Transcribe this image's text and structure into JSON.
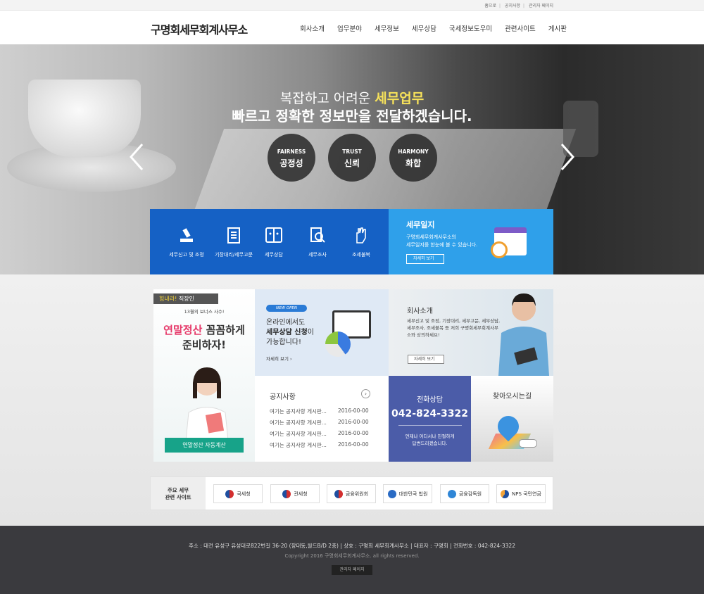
{
  "top_links": [
    "홈으로",
    "공지사항",
    "관리자 페이지"
  ],
  "header": {
    "logo": "구명회세무회계사무소",
    "nav": [
      "회사소개",
      "업무분야",
      "세무정보",
      "세무상담",
      "국세정보도우미",
      "관련사이트",
      "게시판"
    ]
  },
  "hero": {
    "line1_prefix": "복잡하고 어려운 ",
    "line1_highlight": "세무업무",
    "line2": "빠르고 정확한 정보만을 전달하겠습니다.",
    "values": [
      {
        "en": "FAIRNESS",
        "ko": "공정성"
      },
      {
        "en": "TRUST",
        "ko": "신뢰"
      },
      {
        "en": "HARMONY",
        "ko": "화합"
      }
    ]
  },
  "services": [
    {
      "label": "세무신고 및 조정",
      "icon": "seal-stamp-icon"
    },
    {
      "label": "기장대리/세무고문",
      "icon": "document-list-icon"
    },
    {
      "label": "세무상담",
      "icon": "finder-face-icon"
    },
    {
      "label": "세무조사",
      "icon": "magnify-doc-icon"
    },
    {
      "label": "조세불복",
      "icon": "raised-hand-icon"
    }
  ],
  "diary": {
    "title": "세무일지",
    "desc_line1": "구명회세무회계사무소의",
    "desc_line2": "세무일지를 한눈에 볼 수 있습니다.",
    "button": "자세히 보기"
  },
  "promo": {
    "tag_hl": "힘내라!",
    "tag": " 직장인",
    "sub": "13월의 보너스 사수!",
    "head1_hl": "연말정산",
    "head1": " 꼼꼼하게",
    "head2": "준비하자!",
    "button": "연말정산 자동계산"
  },
  "online": {
    "badge": "NEW OPEN",
    "line1": "온라인에서도",
    "line2_bold": "세무상담 신청",
    "line2": "이",
    "line3": "가능합니다!",
    "more": "자세히 보기"
  },
  "company": {
    "title": "회사소개",
    "desc": "세무신고 및 조정, 기장대리, 세무고문, 세무상담, 세무조사, 조세불복 등 저희 구명회세무회계사무소와 상의하세요!",
    "button": "자세히 보기"
  },
  "notice": {
    "title": "공지사항",
    "rows": [
      {
        "title": "여기는 공지사항 게시판...",
        "date": "2016-00-00"
      },
      {
        "title": "여기는 공지사항 게시판...",
        "date": "2016-00-00"
      },
      {
        "title": "여기는 공지사항 게시판...",
        "date": "2016-00-00"
      },
      {
        "title": "여기는 공지사항 게시판...",
        "date": "2016-00-00"
      }
    ]
  },
  "phone": {
    "title": "전화상담",
    "number": "042-824-3322",
    "desc_line1": "언제나 어디서나 친절하게",
    "desc_line2": "답변드리겠습니다."
  },
  "map": {
    "title": "찾아오시는길"
  },
  "sites": {
    "label_line1": "주요 세무",
    "label_line2": "관련 사이트",
    "items": [
      "국세청",
      "관세청",
      "금융위원회",
      "대한민국 법원",
      "금융감독원",
      "NPS 국민연금"
    ]
  },
  "footer": {
    "address": "주소 : 대전 유성구 유성대로822번길 36-20 (장대동,월드B/D 2층)  |  상호 : 구명회 세무회계사무소  |  대표자 : 구명회  |  전화번호 : 042-824-3322",
    "copyright": "Copyright 2016 구명회세무회계사무소. all rights reserved.",
    "admin": "관리자 페이지"
  },
  "colors": {
    "service_blue": "#1561c5",
    "diary_blue": "#2fa0ea",
    "phone_blue": "#4b5ca8",
    "highlight_yellow": "#f7e25a",
    "promo_green": "#17a389",
    "footer_dark": "#3a3a3e"
  }
}
